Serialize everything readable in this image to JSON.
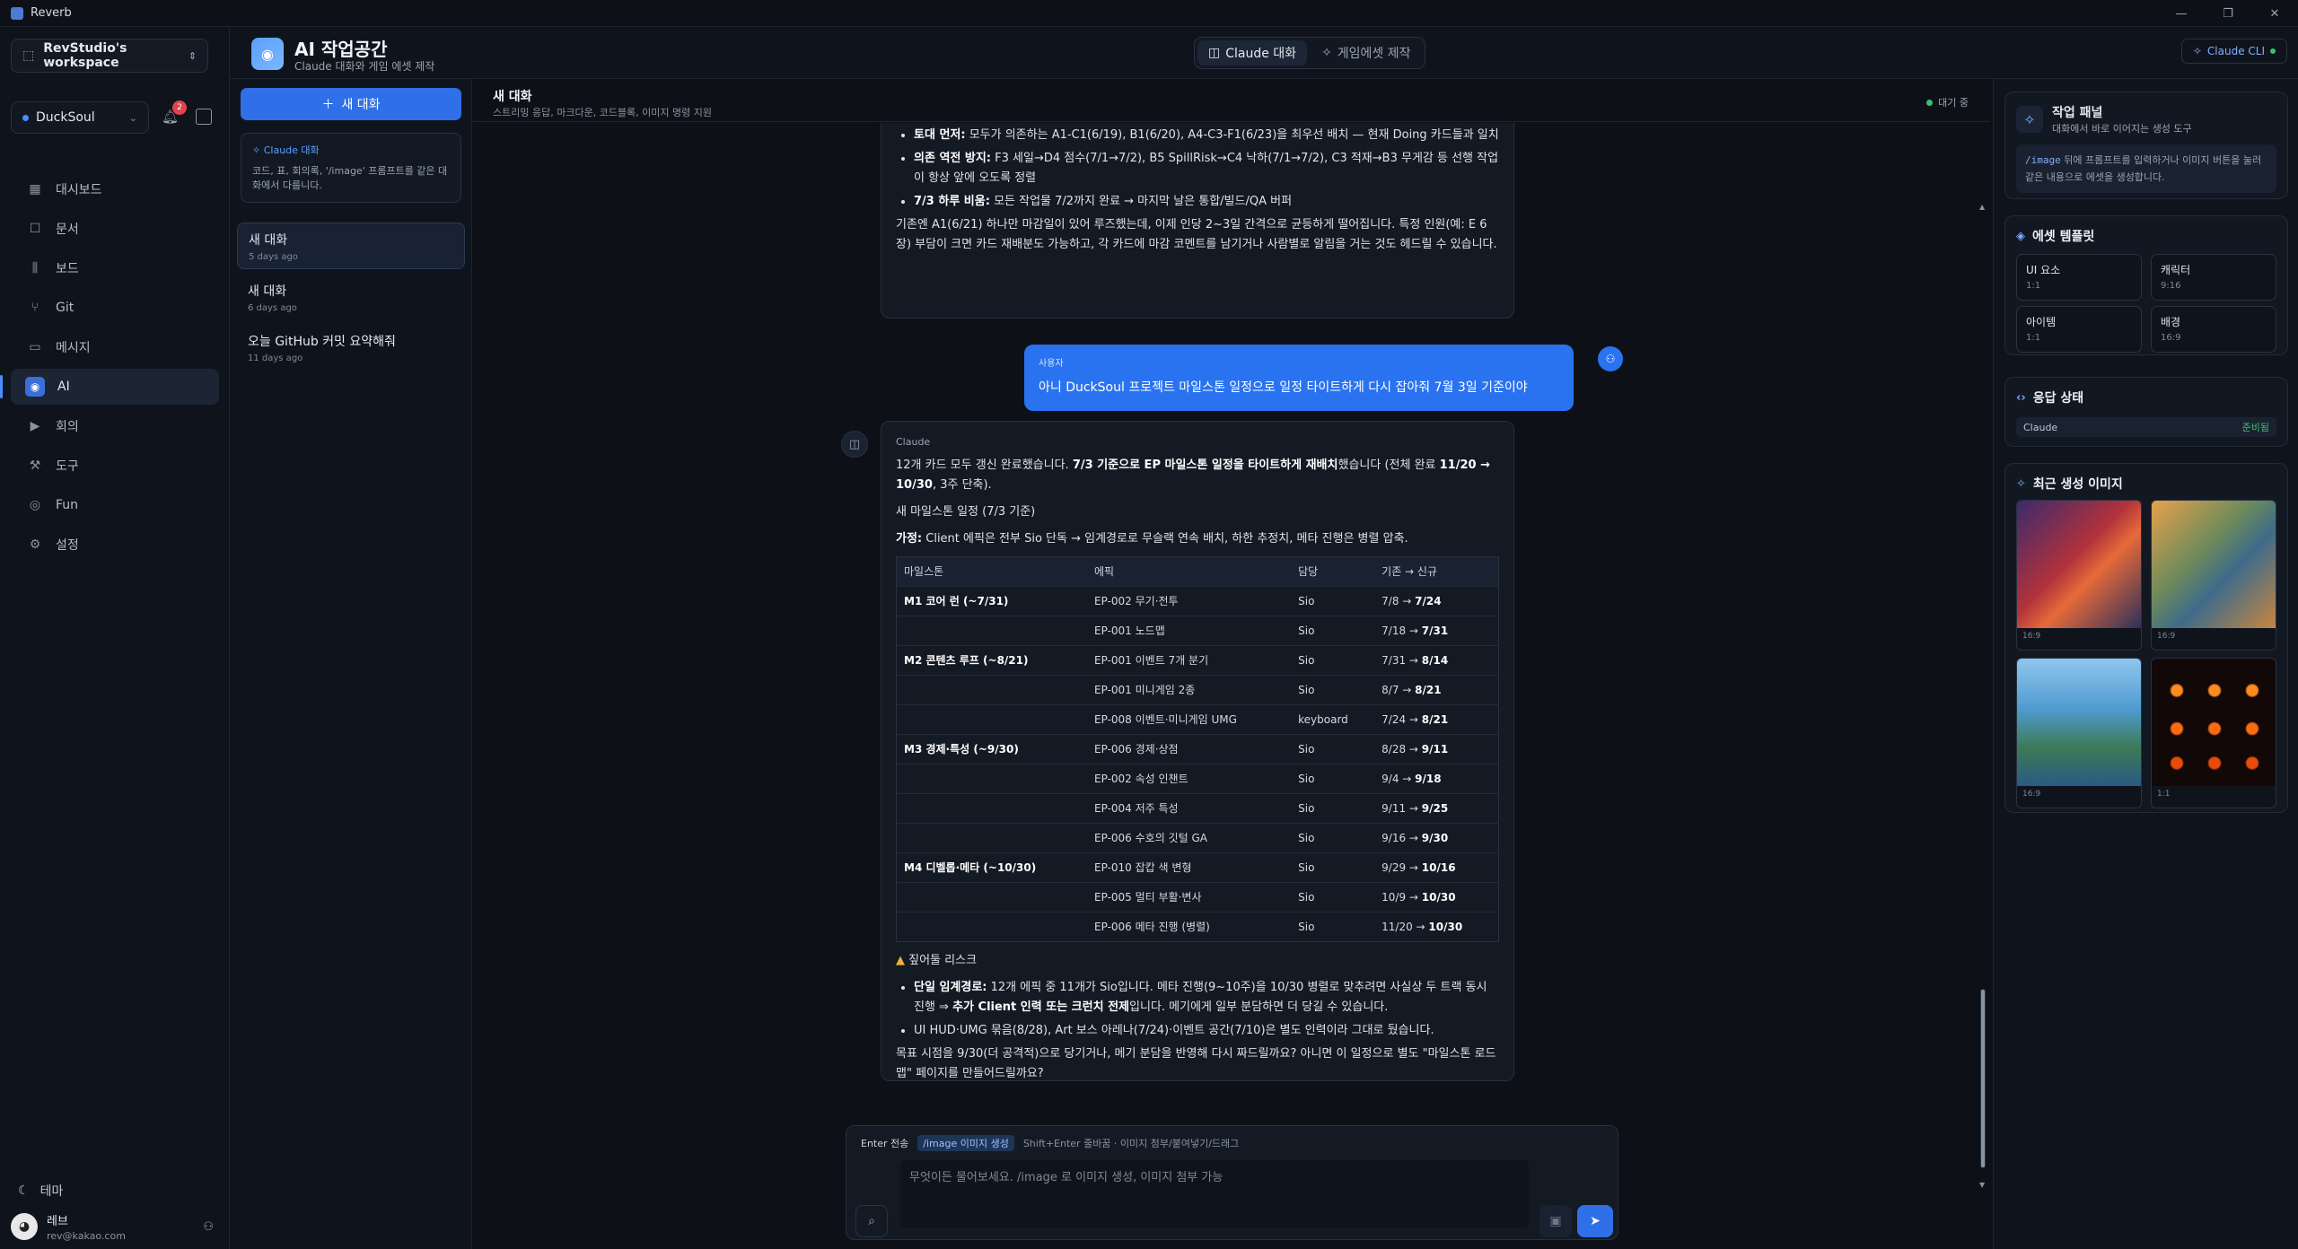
{
  "window": {
    "title": "Reverb",
    "controls": [
      "—",
      "❐",
      "✕"
    ]
  },
  "sidebar": {
    "workspace": "RevStudio's workspace",
    "project": "DuckSoul",
    "notif_count": "2",
    "nav": [
      {
        "label": "대시보드",
        "icon": "dashboard-icon",
        "glyph": "▦"
      },
      {
        "label": "문서",
        "icon": "book-icon",
        "glyph": "☐"
      },
      {
        "label": "보드",
        "icon": "board-icon",
        "glyph": "⫼"
      },
      {
        "label": "Git",
        "icon": "git-icon",
        "glyph": "⑂"
      },
      {
        "label": "메시지",
        "icon": "message-icon",
        "glyph": "▭"
      },
      {
        "label": "AI",
        "icon": "robot-icon",
        "glyph": "◉",
        "active": true
      },
      {
        "label": "회의",
        "icon": "video-icon",
        "glyph": "▶"
      },
      {
        "label": "도구",
        "icon": "wrench-icon",
        "glyph": "⚒"
      },
      {
        "label": "Fun",
        "icon": "gamepad-icon",
        "glyph": "◎"
      },
      {
        "label": "설정",
        "icon": "gear-icon",
        "glyph": "⚙"
      }
    ],
    "theme": "테마",
    "user": {
      "name": "레브",
      "email": "rev@kakao.com"
    }
  },
  "header": {
    "title": "AI 작업공간",
    "subtitle": "Claude 대화와 게임 에셋 제작",
    "tabs": [
      {
        "label": "Claude 대화",
        "active": true
      },
      {
        "label": "게임에셋 제작"
      }
    ],
    "cli": "Claude CLI"
  },
  "convlist": {
    "new_button": "새 대화",
    "info_title": "Claude 대화",
    "info_desc": "코드, 표, 회의록, '/image' 프롬프트를 같은 대화에서 다룹니다.",
    "items": [
      {
        "title": "새 대화",
        "ago": "5 days ago",
        "selected": true
      },
      {
        "title": "새 대화",
        "ago": "6 days ago"
      },
      {
        "title": "오늘 GitHub 커밋 요약해줘",
        "ago": "11 days ago"
      }
    ]
  },
  "chat": {
    "title": "새 대화",
    "subtitle": "스트리밍 응답, 마크다운, 코드블록, 이미지 명령 지원",
    "status": "대기 중",
    "prev": {
      "b1_bold": "토대 먼저:",
      "b1": " 모두가 의존하는 A1-C1(6/19), B1(6/20), A4-C3-F1(6/23)을 최우선 배치 — 현재 Doing 카드들과 일치",
      "b2_bold": "의존 역전 방지:",
      "b2": " F3 세일→D4 점수(7/1→7/2), B5 SpillRisk→C4 낙하(7/1→7/2), C3 적재→B3 무게감 등 선행 작업이 항상 앞에 오도록 정렬",
      "b3_bold": "7/3 하루 비움:",
      "b3": " 모든 작업물 7/2까지 완료 → 마지막 날은 통합/빌드/QA 버퍼",
      "para": "기존엔 A1(6/21) 하나만 마감일이 있어 루즈했는데, 이제 인당 2~3일 간격으로 균등하게 떨어집니다. 특정 인원(예: E 6장) 부담이 크면 카드 재배분도 가능하고, 각 카드에 마감 코멘트를 남기거나 사람별로 알림을 거는 것도 헤드릴 수 있습니다."
    },
    "user_msg": {
      "who": "사용자",
      "text": "아니 DuckSoul 프로젝트 마일스톤 일정으로 일정 타이트하게 다시 잡아줘 7월 3일 기준이야"
    },
    "reply": {
      "who": "Claude",
      "p1a": "12개 카드 모두 갱신 완료했습니다. ",
      "p1b": "7/3 기준으로 EP 마일스톤 일정을 타이트하게 재배치",
      "p1c": "했습니다 (전체 완료 ",
      "p1d": "11/20 → 10/30",
      "p1e": ", 3주 단축).",
      "heading": "새 마일스톤 일정 (7/3 기준)",
      "assume_bold": "가정:",
      "assume": " Client 에픽은 전부 Sio 단독 → 임계경로로 무슬랙 연속 배치, 하한 추정치, 메타 진행은 병렬 압축.",
      "table": {
        "headers": [
          "마일스톤",
          "에픽",
          "담당",
          "기존 → 신규"
        ],
        "rows": [
          {
            "m": "M1 코어 런 (~7/31)",
            "e": "EP-002 무기·전투",
            "o": "Sio",
            "old": "7/8 → ",
            "new": "7/24"
          },
          {
            "m": "",
            "e": "EP-001 노드맵",
            "o": "Sio",
            "old": "7/18 → ",
            "new": "7/31"
          },
          {
            "m": "M2 콘텐츠 루프 (~8/21)",
            "e": "EP-001 이벤트 7개 분기",
            "o": "Sio",
            "old": "7/31 → ",
            "new": "8/14"
          },
          {
            "m": "",
            "e": "EP-001 미니게임 2종",
            "o": "Sio",
            "old": "8/7 → ",
            "new": "8/21"
          },
          {
            "m": "",
            "e": "EP-008 이벤트·미니게임 UMG",
            "o": "keyboard",
            "old": "7/24 → ",
            "new": "8/21"
          },
          {
            "m": "M3 경제·특성 (~9/30)",
            "e": "EP-006 경제·상점",
            "o": "Sio",
            "old": "8/28 → ",
            "new": "9/11"
          },
          {
            "m": "",
            "e": "EP-002 속성 인챈트",
            "o": "Sio",
            "old": "9/4 → ",
            "new": "9/18"
          },
          {
            "m": "",
            "e": "EP-004 저주 특성",
            "o": "Sio",
            "old": "9/11 → ",
            "new": "9/25"
          },
          {
            "m": "",
            "e": "EP-006 수호의 깃털 GA",
            "o": "Sio",
            "old": "9/16 → ",
            "new": "9/30"
          },
          {
            "m": "M4 디벨롭·메타 (~10/30)",
            "e": "EP-010 잡캅 색 변형",
            "o": "Sio",
            "old": "9/29 → ",
            "new": "10/16"
          },
          {
            "m": "",
            "e": "EP-005 멀티 부활·변사",
            "o": "Sio",
            "old": "10/9 → ",
            "new": "10/30"
          },
          {
            "m": "",
            "e": "EP-006 메타 진행 (병렬)",
            "o": "Sio",
            "old": "11/20 → ",
            "new": "10/30"
          }
        ]
      },
      "risk_title": "짚어둘 리스크",
      "r1_bold": "단일 임계경로:",
      "r1a": " 12개 에픽 중 11개가 Sio입니다. 메타 진행(9~10주)을 10/30 병렬로 맞추려면 사실상 두 트랙 동시 진행 ⇒ ",
      "r1b": "추가 Client 인력 또는 크런치 전제",
      "r1c": "입니다. 메기에게 일부 분담하면 더 당길 수 있습니다.",
      "r2": "UI HUD·UMG 묶음(8/28), Art 보스 아레나(7/24)·이벤트 공간(7/10)은 별도 인력이라 그대로 뒀습니다.",
      "closing": "목표 시점을 9/30(더 공격적)으로 당기거나, 메기 분담을 반영해 다시 짜드릴까요? 아니면 이 일정으로 별도 \"마일스톤 로드맵\" 페이지를 만들어드릴까요?"
    }
  },
  "composer": {
    "hint_enter": "Enter 전송",
    "hint_image": "/image 이미지 생성",
    "hint_rest": "Shift+Enter 줄바꿈 · 이미지 첨부/붙여넣기/드래그",
    "placeholder": "무엇이든 물어보세요. /image 로 이미지 생성, 이미지 첨부 가능"
  },
  "right": {
    "work": {
      "title": "작업 패널",
      "subtitle": "대화에서 바로 이어지는 생성 도구",
      "code": "/image",
      "desc": " 뒤에 프롬프트를 입력하거나 이미지 버튼을 눌러 같은 내용으로 에셋을 생성합니다."
    },
    "templates": {
      "title": "에셋 템플릿",
      "items": [
        {
          "name": "UI 요소",
          "ratio": "1:1"
        },
        {
          "name": "캐릭터",
          "ratio": "9:16"
        },
        {
          "name": "아이템",
          "ratio": "1:1"
        },
        {
          "name": "배경",
          "ratio": "16:9"
        }
      ]
    },
    "status": {
      "title": "응답 상태",
      "name": "Claude",
      "state": "준비됨"
    },
    "recent": {
      "title": "최근 생성 이미지",
      "items": [
        {
          "ratio": "16:9"
        },
        {
          "ratio": "16:9"
        },
        {
          "ratio": "16:9"
        },
        {
          "ratio": "1:1"
        }
      ]
    }
  },
  "colors": {
    "accent": "#2f6fe8",
    "bg": "#0d1117",
    "ok": "#35c46d"
  }
}
